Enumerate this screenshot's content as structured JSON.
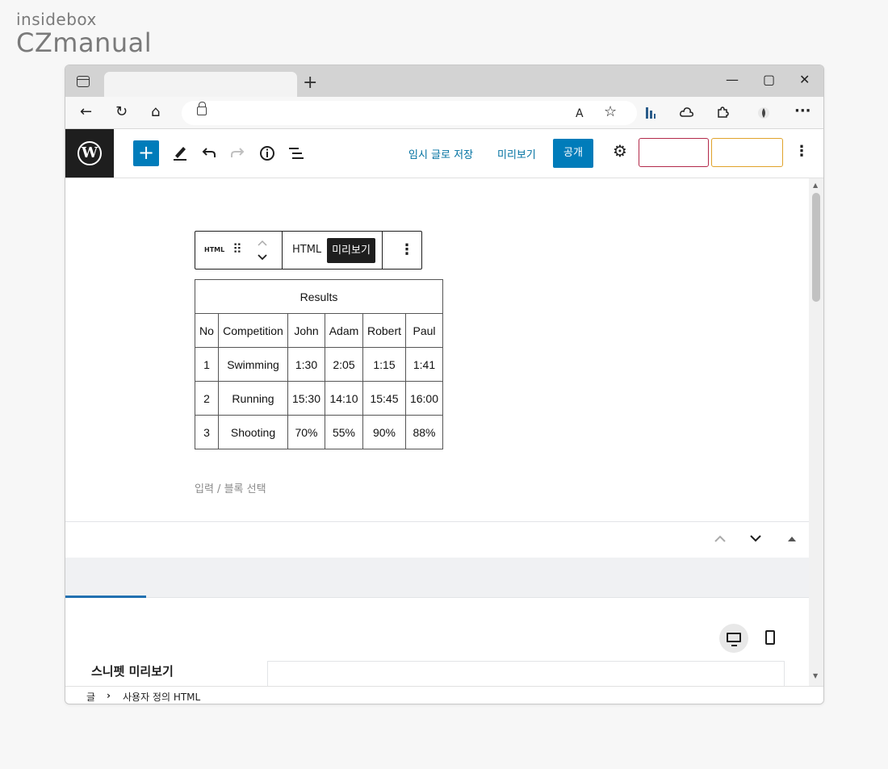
{
  "watermark": {
    "top": "insidebox",
    "bottom": "CZmanual"
  },
  "browser": {
    "new_tab": "+",
    "controls": {
      "minimize": "—",
      "maximize": "▢",
      "close": "✕"
    },
    "nav": {
      "back": "←",
      "refresh": "↻",
      "home": "⌂"
    },
    "toolbar_icons": {
      "read_aloud": "A",
      "favorite": "☆",
      "more": "···"
    }
  },
  "editor": {
    "logo": "W",
    "save_draft": "임시 글로 저장",
    "preview": "미리보기",
    "publish": "공개"
  },
  "block": {
    "type_label": "HTML",
    "html_tab": "HTML",
    "preview_tab": "미리보기",
    "appender_placeholder": "입력 / 블록 선택"
  },
  "table": {
    "caption": "Results",
    "headers": [
      "No",
      "Competition",
      "John",
      "Adam",
      "Robert",
      "Paul"
    ],
    "rows": [
      [
        "1",
        "Swimming",
        "1:30",
        "2:05",
        "1:15",
        "1:41"
      ],
      [
        "2",
        "Running",
        "15:30",
        "14:10",
        "15:45",
        "16:00"
      ],
      [
        "3",
        "Shooting",
        "70%",
        "55%",
        "90%",
        "88%"
      ]
    ]
  },
  "panel": {
    "snippet_label": "스니펫 미리보기"
  },
  "breadcrumb": {
    "root": "글",
    "separator": "›",
    "current": "사용자 정의 HTML"
  },
  "colors": {
    "wp_blue": "#007cba",
    "link_blue": "#0071a1",
    "dark": "#1e1e1e",
    "plugin_red": "#b3294a",
    "plugin_orange": "#e0a22a"
  }
}
